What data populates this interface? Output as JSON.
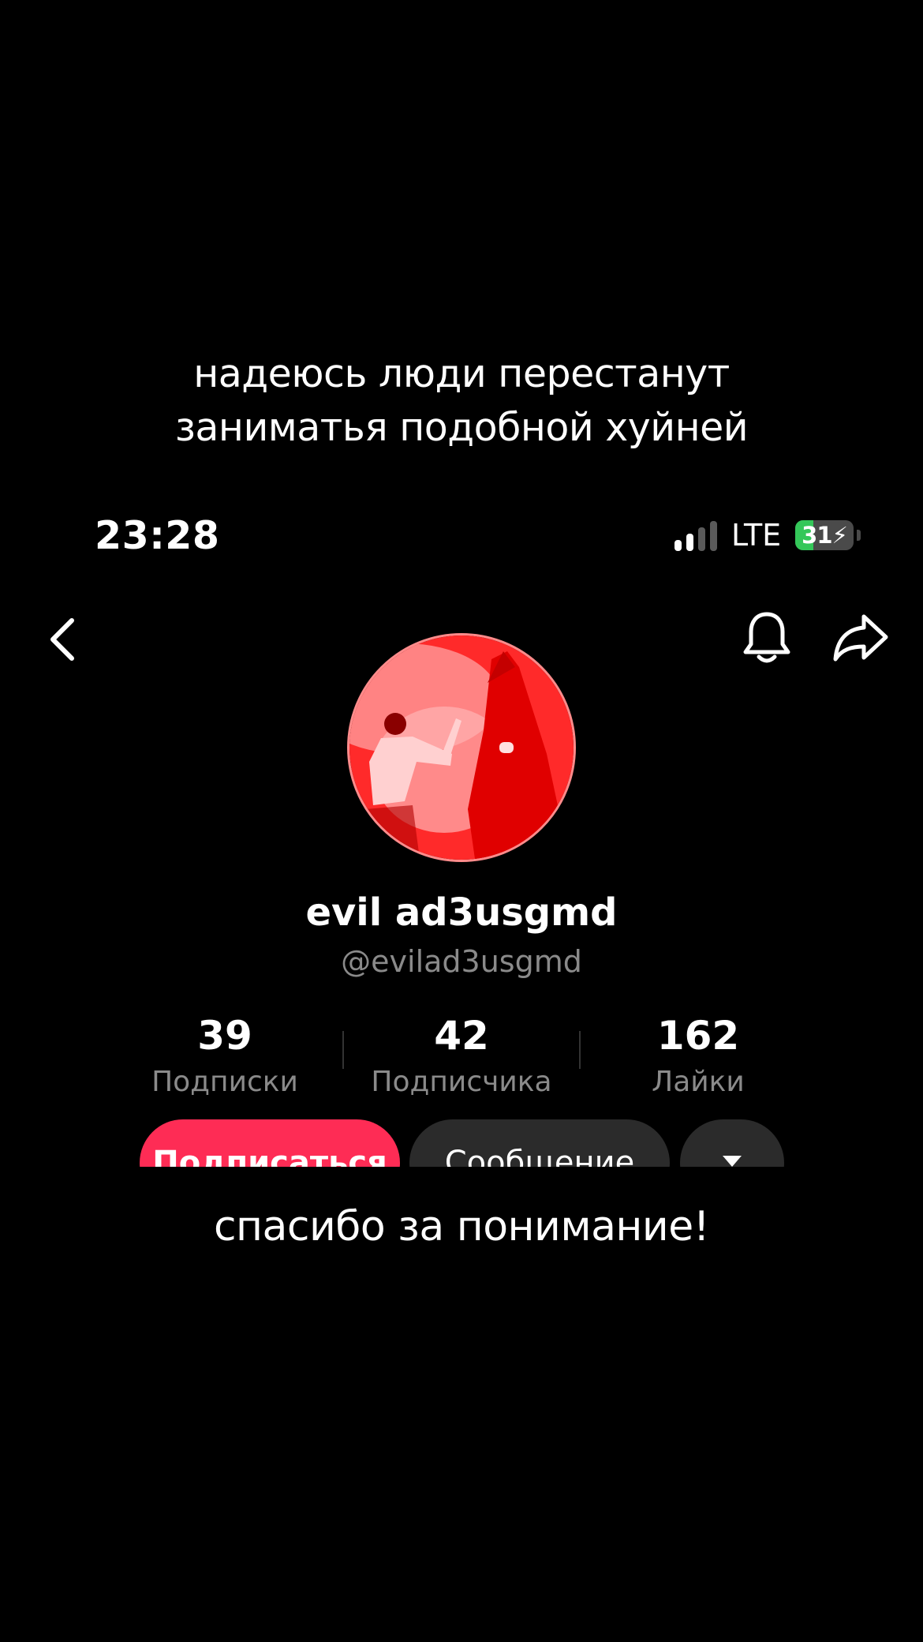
{
  "caption_top": {
    "line1": "надеюсь люди перестанут",
    "line2": "заниматья подобной хуйней"
  },
  "caption_bottom": "спасибо за понимание!",
  "status_bar": {
    "time": "23:28",
    "network": "LTE",
    "battery_level": "31",
    "battery_fraction": 0.31,
    "signal_bars_active": 2,
    "signal_bars_total": 4
  },
  "nav": {
    "back_icon": "chevron-left-icon",
    "bell_icon": "bell-icon",
    "share_icon": "share-arrow-icon"
  },
  "profile": {
    "display_name": "evil ad3usgmd",
    "username": "@evilad3usgmd"
  },
  "stats": [
    {
      "value": "39",
      "label": "Подписки"
    },
    {
      "value": "42",
      "label": "Подписчика"
    },
    {
      "value": "162",
      "label": "Лайки"
    }
  ],
  "actions": {
    "follow_label": "Подписаться",
    "message_label": "Сообщение",
    "more_icon": "chevron-down-icon"
  },
  "colors": {
    "background": "#000000",
    "follow": "#fe2c55",
    "secondary_button": "#2b2b2b",
    "muted_text": "#8a8a8a",
    "battery_green": "#34c759",
    "avatar_tint": "#ff1a1a"
  }
}
